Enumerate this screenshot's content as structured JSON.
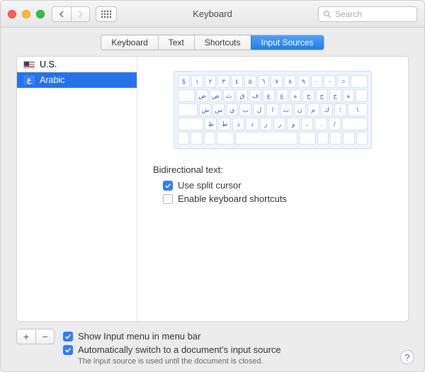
{
  "window": {
    "title": "Keyboard",
    "search_placeholder": "Search"
  },
  "tabs": [
    {
      "label": "Keyboard"
    },
    {
      "label": "Text"
    },
    {
      "label": "Shortcuts"
    },
    {
      "label": "Input Sources"
    }
  ],
  "active_tab": 3,
  "sources": [
    {
      "label": "U.S.",
      "selected": false,
      "icon": "flag-us"
    },
    {
      "label": "Arabic",
      "selected": true,
      "icon": "flag-ar",
      "icon_glyph": "ع"
    }
  ],
  "keyboard_preview": {
    "rows": [
      [
        "§",
        "١",
        "٢",
        "٣",
        "٤",
        "٥",
        "٦",
        "٧",
        "٨",
        "٩",
        "٠",
        "-",
        "=",
        " "
      ],
      [
        " ",
        "ض",
        "ص",
        "ث",
        "ق",
        "ف",
        "غ",
        "ع",
        "ه",
        "خ",
        "ح",
        "ج",
        "ة",
        " "
      ],
      [
        " ",
        "ش",
        "س",
        "ي",
        "ب",
        "ل",
        "ا",
        "ت",
        "ن",
        "م",
        "ك",
        "؛",
        "\\"
      ],
      [
        " ",
        "ظ",
        "ط",
        "ذ",
        "د",
        "ز",
        "ر",
        "و",
        "،",
        ".",
        "/",
        " "
      ],
      [
        "",
        " ",
        " ",
        " ",
        "",
        "",
        "",
        " ",
        " ",
        ""
      ]
    ]
  },
  "bidirectional": {
    "heading": "Bidirectional text:",
    "split_cursor": {
      "label": "Use split cursor",
      "checked": true
    },
    "enable_shortcuts": {
      "label": "Enable keyboard shortcuts",
      "checked": false
    }
  },
  "footer": {
    "show_menu": {
      "label": "Show Input menu in menu bar",
      "checked": true
    },
    "auto_switch": {
      "label": "Automatically switch to a document’s input source",
      "checked": true
    },
    "hint": "The input source is used until the document is closed."
  }
}
